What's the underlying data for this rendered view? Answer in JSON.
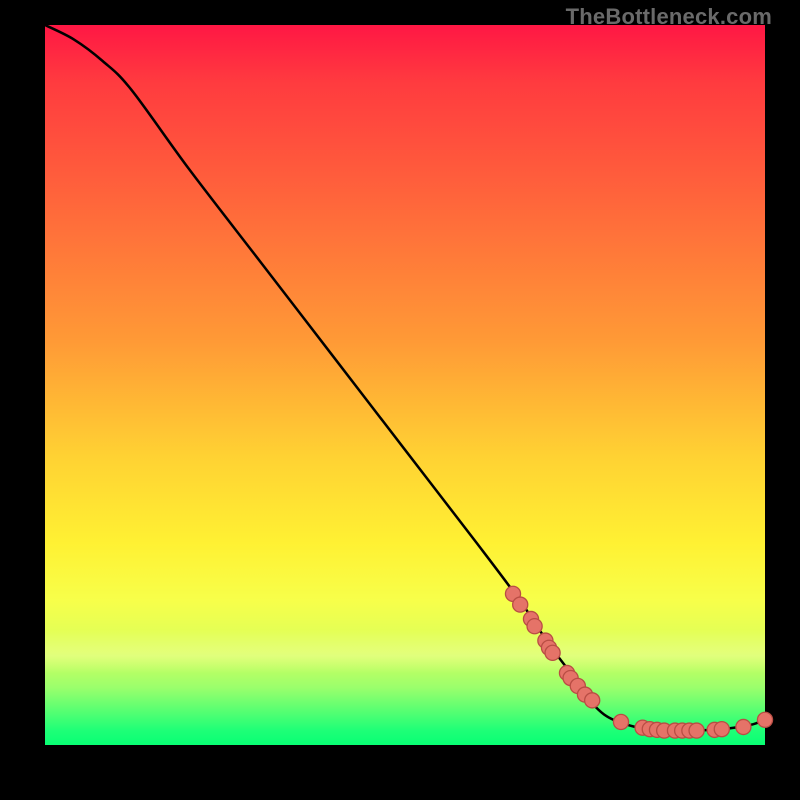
{
  "watermark": "TheBottleneck.com",
  "colors": {
    "background": "#000000",
    "curve": "#000000",
    "marker_fill": "#e57368",
    "marker_stroke": "#b94d44",
    "gradient_top": "#ff1744",
    "gradient_mid": "#fff133",
    "gradient_bottom": "#08ff74"
  },
  "chart_data": {
    "type": "line",
    "title": "",
    "xlabel": "",
    "ylabel": "",
    "xlim": [
      0,
      100
    ],
    "ylim": [
      0,
      100
    ],
    "grid": false,
    "legend": false,
    "series": [
      {
        "name": "bottleneck-curve",
        "x": [
          0,
          4,
          8,
          12,
          20,
          30,
          40,
          50,
          60,
          66,
          70,
          73,
          75,
          78,
          82,
          86,
          90,
          94,
          98,
          100
        ],
        "y": [
          100,
          98,
          95,
          91,
          80,
          67,
          54,
          41,
          28,
          20,
          14,
          10,
          7,
          4,
          2.5,
          2,
          2,
          2.2,
          2.8,
          3.5
        ]
      }
    ],
    "markers": {
      "name": "highlighted-points",
      "points": [
        {
          "x": 65,
          "y": 21
        },
        {
          "x": 66,
          "y": 19.5
        },
        {
          "x": 67.5,
          "y": 17.5
        },
        {
          "x": 68,
          "y": 16.5
        },
        {
          "x": 69.5,
          "y": 14.5
        },
        {
          "x": 70,
          "y": 13.5
        },
        {
          "x": 70.5,
          "y": 12.8
        },
        {
          "x": 72.5,
          "y": 10
        },
        {
          "x": 73,
          "y": 9.3
        },
        {
          "x": 74,
          "y": 8.2
        },
        {
          "x": 75,
          "y": 7
        },
        {
          "x": 76,
          "y": 6.2
        },
        {
          "x": 80,
          "y": 3.2
        },
        {
          "x": 83,
          "y": 2.4
        },
        {
          "x": 84,
          "y": 2.2
        },
        {
          "x": 85,
          "y": 2.1
        },
        {
          "x": 86,
          "y": 2.0
        },
        {
          "x": 87.5,
          "y": 2.0
        },
        {
          "x": 88.5,
          "y": 2.0
        },
        {
          "x": 89.5,
          "y": 2.0
        },
        {
          "x": 90.5,
          "y": 2.0
        },
        {
          "x": 93,
          "y": 2.1
        },
        {
          "x": 94,
          "y": 2.2
        },
        {
          "x": 97,
          "y": 2.5
        },
        {
          "x": 100,
          "y": 3.5
        }
      ]
    }
  }
}
